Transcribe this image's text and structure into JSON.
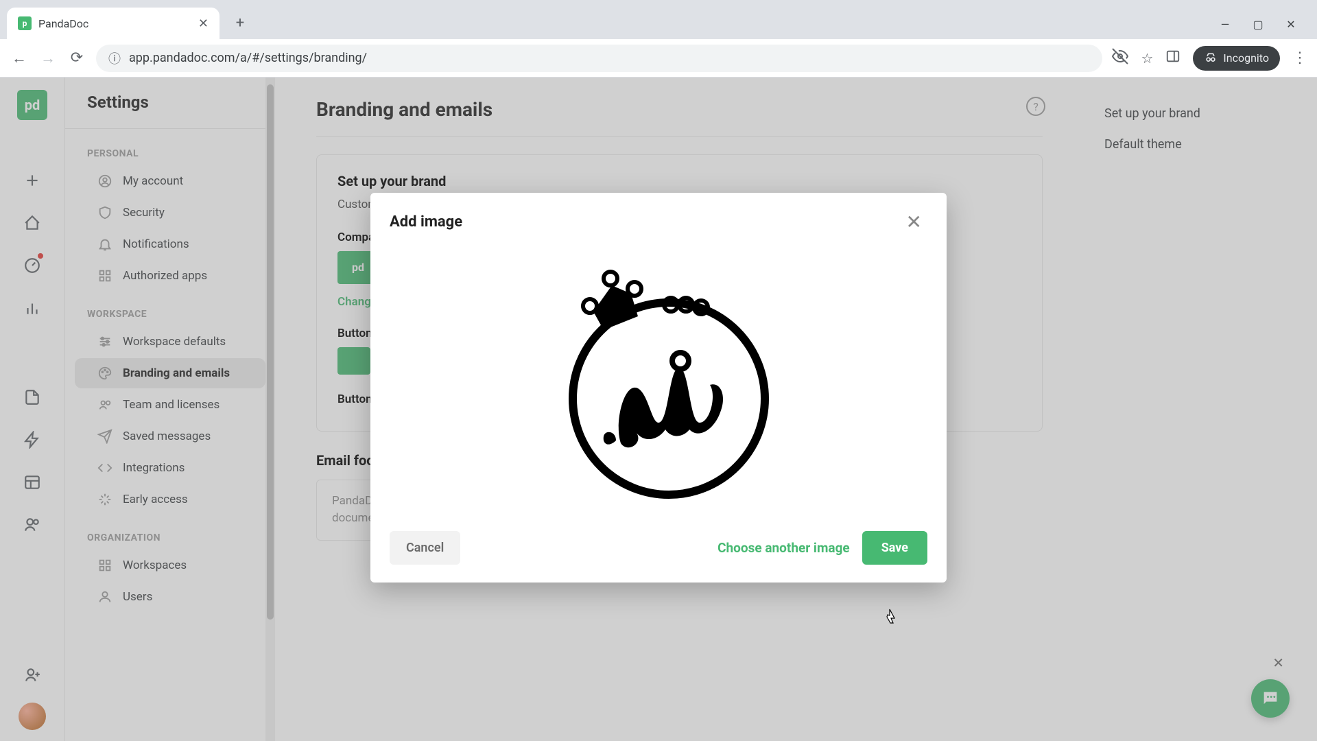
{
  "browser": {
    "tab_title": "PandaDoc",
    "url": "app.pandadoc.com/a/#/settings/branding/",
    "incognito_label": "Incognito"
  },
  "page": {
    "title": "Settings"
  },
  "sidebar": {
    "groups": {
      "personal": "PERSONAL",
      "workspace": "WORKSPACE",
      "organization": "ORGANIZATION"
    },
    "items": {
      "my_account": "My account",
      "security": "Security",
      "notifications": "Notifications",
      "authorized_apps": "Authorized apps",
      "workspace_defaults": "Workspace defaults",
      "branding": "Branding and emails",
      "team": "Team and licenses",
      "saved_messages": "Saved messages",
      "integrations": "Integrations",
      "early_access": "Early access",
      "workspaces": "Workspaces",
      "users": "Users"
    }
  },
  "main": {
    "heading": "Branding and emails",
    "card_title": "Set up your brand",
    "card_desc": "Customize the logo and the color of emails",
    "company_logo_label": "Company logo",
    "change_link": "Change",
    "button_color_label": "Button color",
    "button_text_label": "Button text",
    "email_footer_label": "Email footer text",
    "email_footer_value": "PandaDoc is an application to create, send, track, sign and annotate documents in a fast, secure and professional way."
  },
  "right_nav": {
    "brand": "Set up your brand",
    "theme": "Default theme"
  },
  "modal": {
    "title": "Add image",
    "cancel": "Cancel",
    "choose": "Choose another image",
    "save": "Save"
  },
  "colors": {
    "accent": "#47b972"
  }
}
